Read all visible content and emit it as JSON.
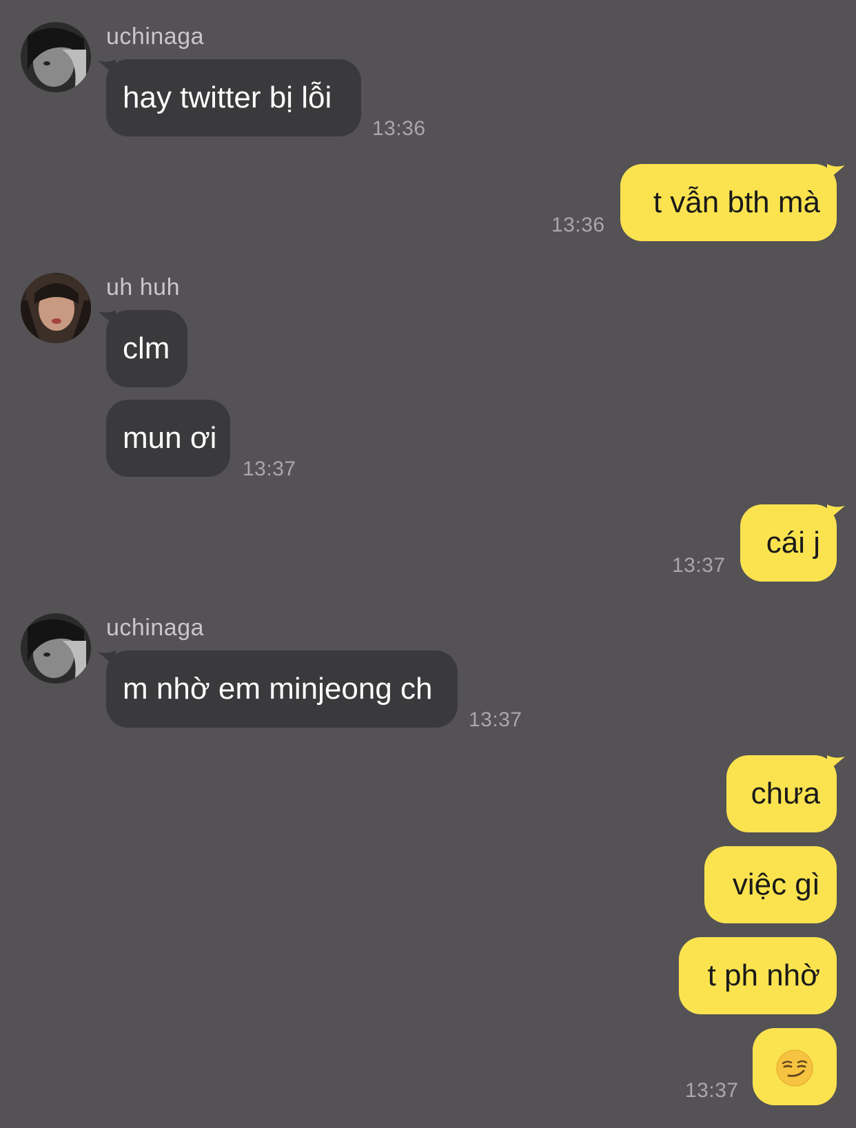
{
  "messages": [
    {
      "sender": "uchinaga",
      "text": "hay twitter bị lỗi",
      "time": "13:36"
    },
    {
      "text": "t vẫn bth mà",
      "time": "13:36"
    },
    {
      "sender": "uh huh",
      "text": "clm"
    },
    {
      "text": "mun ơi",
      "time": "13:37"
    },
    {
      "text": "cái j",
      "time": "13:37"
    },
    {
      "sender": "uchinaga",
      "text": "m nhờ em minjeong ch",
      "time": "13:37"
    },
    {
      "text": "chưa"
    },
    {
      "text": "việc gì"
    },
    {
      "text": "t ph nhờ"
    },
    {
      "emoji": "smirking-face-emoji",
      "time": "13:37"
    }
  ],
  "colors": {
    "background": "#545254",
    "incoming_bubble": "#3a393b",
    "outgoing_bubble": "#fae34f",
    "timestamp": "#a9a7a9",
    "sender_name": "#c9c7c9"
  }
}
